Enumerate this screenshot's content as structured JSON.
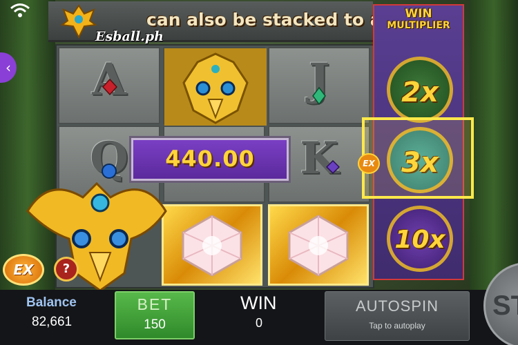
{
  "banner": {
    "text": "can also be stacked to a fi"
  },
  "logo": {
    "text": "Esball.ph"
  },
  "reels": {
    "letters": [
      "A",
      "Q",
      "J",
      "K"
    ]
  },
  "win_popup": {
    "amount": "440.00"
  },
  "multiplier": {
    "title_line1": "WIN",
    "title_line2": "MULTIPLIER",
    "values": [
      "2x",
      "3x",
      "10x"
    ],
    "active": "3x",
    "ex_marker": "EX"
  },
  "controls": {
    "ex_badge": "EX",
    "help": "?",
    "back": "‹"
  },
  "bottom_bar": {
    "balance_label": "Balance",
    "balance_value": "82,661",
    "bet_label": "BET",
    "bet_value": "150",
    "win_label": "WIN",
    "win_value": "0",
    "autospin_label": "AUTOSPIN",
    "autospin_sub": "Tap to autoplay",
    "spin_label": "ST"
  },
  "colors": {
    "gold": "#ffd43a",
    "bet_green": "#3f9a36",
    "multiplier_purple": "#4f3782",
    "highlight_yellow": "#ffe94a"
  }
}
